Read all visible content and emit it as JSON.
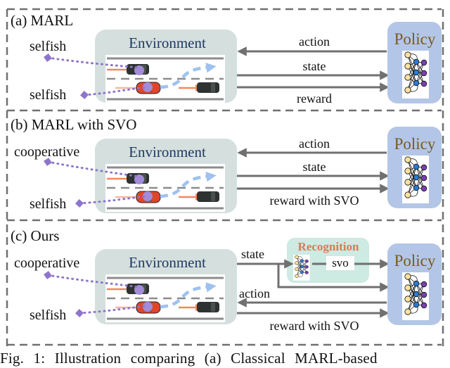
{
  "figure": {
    "caption": "Fig. 1: Illustration comparing (a) Classical MARL-based",
    "colors": {
      "frame": "#707070",
      "environment_bg": "#d5e0de",
      "policy_bg": "#b3c6e7",
      "recognition_bg": "#cdeae3",
      "policy_text": "#7a5a1a",
      "environment_text": "#1f3864",
      "recognition_text": "#d97a52",
      "arrow": "#707070",
      "dotted_link": "#8e75c9",
      "trajectory": "#9ec1f0",
      "velocity": "#f4875a"
    },
    "panels": [
      {
        "id": "a",
        "title": "(a) MARL",
        "agent_labels": [
          "selfish",
          "selfish"
        ],
        "environment_label": "Environment",
        "policy_label": "Policy",
        "arrows": [
          {
            "label": "action",
            "direction": "policy-to-environment"
          },
          {
            "label": "state",
            "direction": "environment-to-policy"
          },
          {
            "label": "reward",
            "direction": "environment-to-policy"
          }
        ]
      },
      {
        "id": "b",
        "title": "(b) MARL with SVO",
        "agent_labels": [
          "cooperative",
          "selfish"
        ],
        "environment_label": "Environment",
        "policy_label": "Policy",
        "arrows": [
          {
            "label": "action",
            "direction": "policy-to-environment"
          },
          {
            "label": "state",
            "direction": "environment-to-policy"
          },
          {
            "label": "reward with SVO",
            "direction": "environment-to-policy"
          }
        ]
      },
      {
        "id": "c",
        "title": "(c) Ours",
        "agent_labels": [
          "cooperative",
          "selfish"
        ],
        "environment_label": "Environment",
        "policy_label": "Policy",
        "recognition_label": "Recognition",
        "svo_label": "svo",
        "arrows": [
          {
            "label": "state",
            "direction": "environment-to-recognition"
          },
          {
            "label": "action",
            "direction": "policy-to-environment"
          },
          {
            "label": "reward with SVO",
            "direction": "environment-to-policy"
          }
        ]
      }
    ]
  }
}
